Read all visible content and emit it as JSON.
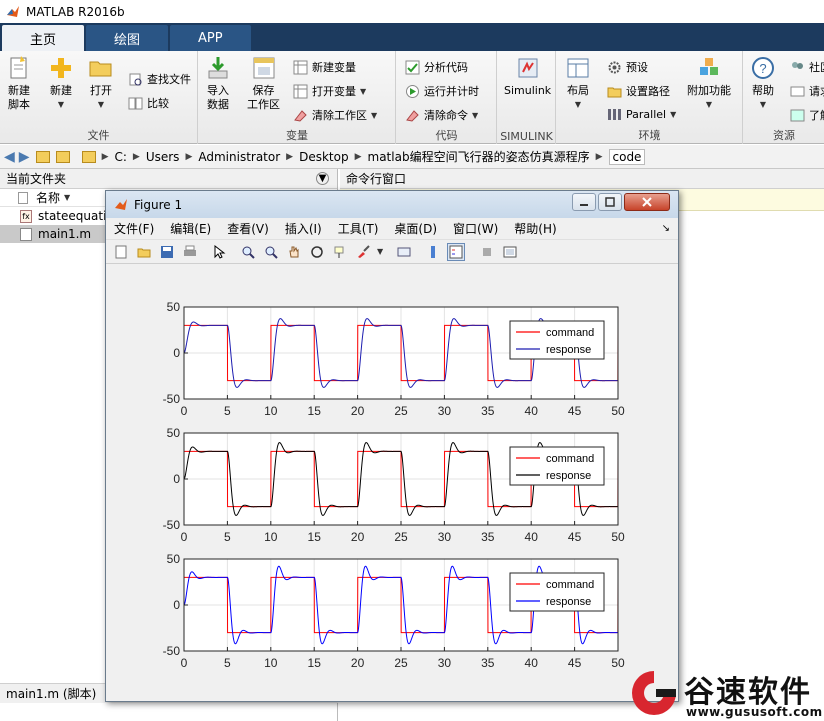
{
  "app": {
    "title": "MATLAB R2016b"
  },
  "tabs": [
    {
      "label": "主页"
    },
    {
      "label": "绘图"
    },
    {
      "label": "APP"
    }
  ],
  "ribbon": {
    "file": {
      "group": "文件",
      "new_script": "新建\n脚本",
      "new": "新建",
      "open": "打开",
      "find_files": "查找文件",
      "compare": "比较"
    },
    "variable": {
      "group": "变量",
      "import": "导入\n数据",
      "save_ws": "保存\n工作区",
      "new_var": "新建变量",
      "open_var": "打开变量",
      "clear_ws": "清除工作区"
    },
    "code": {
      "group": "代码",
      "analyze": "分析代码",
      "run_time": "运行并计时",
      "clear_cmd": "清除命令"
    },
    "simulink": {
      "group": "SIMULINK",
      "label": "Simulink"
    },
    "env": {
      "group": "环境",
      "layout": "布局",
      "prefs": "预设",
      "set_path": "设置路径",
      "parallel": "Parallel",
      "addons": "附加功能"
    },
    "resources": {
      "group": "资源",
      "help": "帮助",
      "community": "社区",
      "request": "请求",
      "learn": "了解"
    }
  },
  "address": {
    "crumbs": [
      "C:",
      "Users",
      "Administrator",
      "Desktop",
      "matlab编程空间飞行器的姿态仿真源程序",
      "code"
    ]
  },
  "left": {
    "title": "当前文件夹",
    "col": "名称",
    "files": [
      {
        "name": "stateequati"
      },
      {
        "name": "main1.m"
      }
    ],
    "status": "main1.m  (脚本)"
  },
  "cmd": {
    "title": "命令行窗口"
  },
  "figure": {
    "title": "Figure 1",
    "menu": [
      "文件(F)",
      "编辑(E)",
      "查看(V)",
      "插入(I)",
      "工具(T)",
      "桌面(D)",
      "窗口(W)",
      "帮助(H)"
    ]
  },
  "chart_data": [
    {
      "type": "line",
      "x": [
        0,
        50
      ],
      "ylim": [
        -50,
        50
      ],
      "xticks": [
        0,
        5,
        10,
        15,
        20,
        25,
        30,
        35,
        40,
        45,
        50
      ],
      "yticks": [
        -50,
        0,
        50
      ],
      "series": [
        {
          "name": "command",
          "color": "#ff0000"
        },
        {
          "name": "response",
          "color": "#1c1cb0"
        }
      ],
      "legend": "top-right"
    },
    {
      "type": "line",
      "x": [
        0,
        50
      ],
      "ylim": [
        -50,
        50
      ],
      "xticks": [
        0,
        5,
        10,
        15,
        20,
        25,
        30,
        35,
        40,
        45,
        50
      ],
      "yticks": [
        -50,
        0,
        50
      ],
      "series": [
        {
          "name": "command",
          "color": "#ff0000"
        },
        {
          "name": "response",
          "color": "#000000"
        }
      ],
      "legend": "top-right"
    },
    {
      "type": "line",
      "x": [
        0,
        50
      ],
      "ylim": [
        -50,
        50
      ],
      "xticks": [
        0,
        5,
        10,
        15,
        20,
        25,
        30,
        35,
        40,
        45,
        50
      ],
      "yticks": [
        -50,
        0,
        50
      ],
      "series": [
        {
          "name": "command",
          "color": "#ff0000"
        },
        {
          "name": "response",
          "color": "#0000ff"
        }
      ],
      "legend": "top-right"
    }
  ],
  "command_signal": {
    "high": 30,
    "low": -30,
    "period": 10,
    "duty_high": 5
  },
  "watermark": {
    "brand": "谷速软件",
    "url": "www.gususoft.com"
  }
}
